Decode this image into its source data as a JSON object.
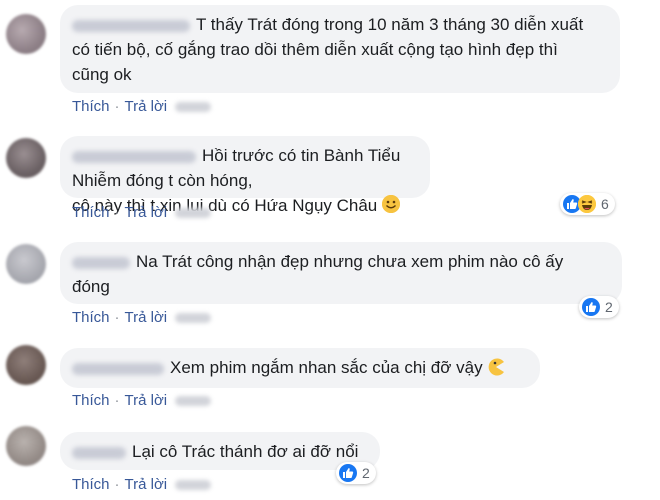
{
  "colors": {
    "bubble": "#f2f3f5",
    "action_link": "#385898",
    "like_blue": "#1877f2",
    "haha_yellow": "#fcc83f"
  },
  "actions": {
    "like": "Thích",
    "reply": "Trả lời",
    "separator": "·"
  },
  "comments": [
    {
      "line1": "T thấy Trát đóng trong 10 năm 3 tháng 30 diễn xuất",
      "line2": "có tiến bộ, cố gắng trao dồi thêm diễn xuất cộng tạo hình đẹp thì",
      "line3": "cũng ok"
    },
    {
      "line1": "Hồi trước có tin Bành Tiểu Nhiễm đóng t còn hóng,",
      "line2": "cô này thì t xin lui dù có Hứa Ngụy Châu",
      "emoji": "smile-emoji",
      "reactions": [
        "like",
        "haha"
      ],
      "reaction_count": "6"
    },
    {
      "line1": "Na Trát công nhận đẹp nhưng chưa xem phim nào cô ấy",
      "line2": "đóng",
      "reactions": [
        "like"
      ],
      "reaction_count": "2"
    },
    {
      "line1": "Xem phim ngắm nhan sắc của chị đỡ vậy",
      "emoji": "pacman-emoji"
    },
    {
      "line1": "Lại cô Trác thánh đơ ai đỡ nổi",
      "reactions": [
        "like"
      ],
      "reaction_count": "2"
    }
  ]
}
